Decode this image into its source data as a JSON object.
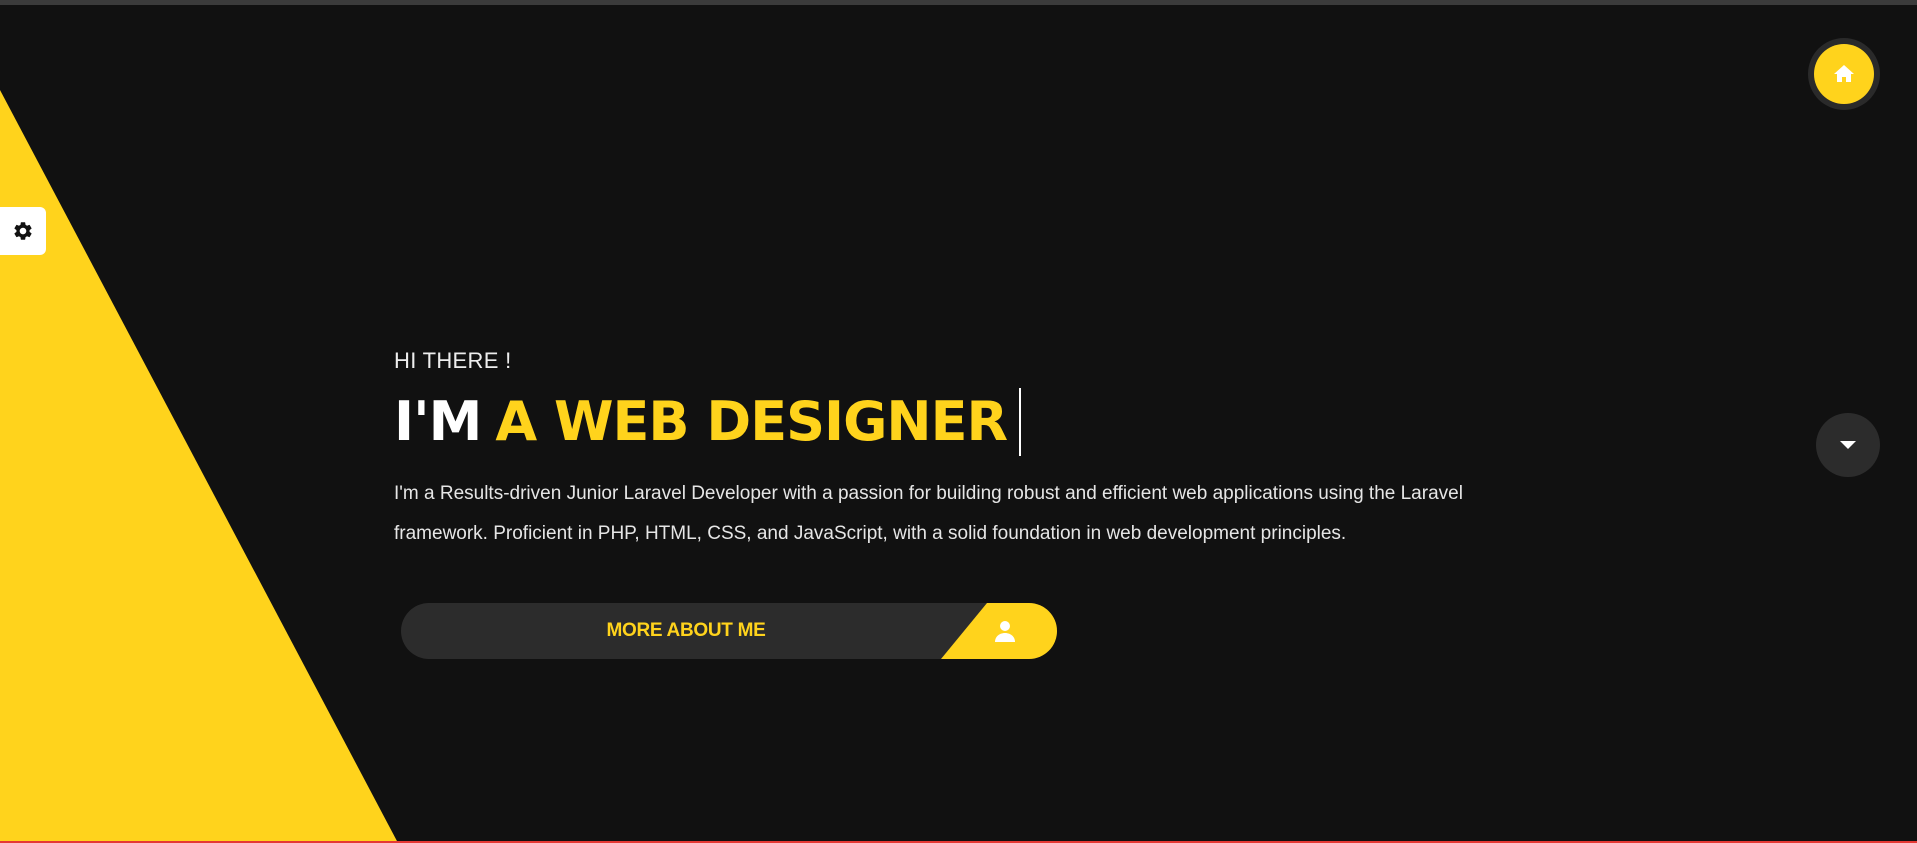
{
  "hero": {
    "greeting": "HI THERE !",
    "headline_prefix": "I'M",
    "headline_role": "A WEB DESIGNER",
    "description": "I'm a Results-driven Junior Laravel Developer with a passion for building robust and efficient web applications using the Laravel framework. Proficient in PHP, HTML, CSS, and JavaScript, with a solid foundation in web development principles.",
    "cta_label": "MORE ABOUT ME"
  },
  "icons": {
    "settings": "gear-icon",
    "home": "home-icon",
    "scroll_down": "caret-down-icon",
    "cta": "user-icon"
  },
  "colors": {
    "background": "#111111",
    "accent": "#ffd31c",
    "button_bg": "#2c2c2c",
    "text": "#ffffff"
  }
}
